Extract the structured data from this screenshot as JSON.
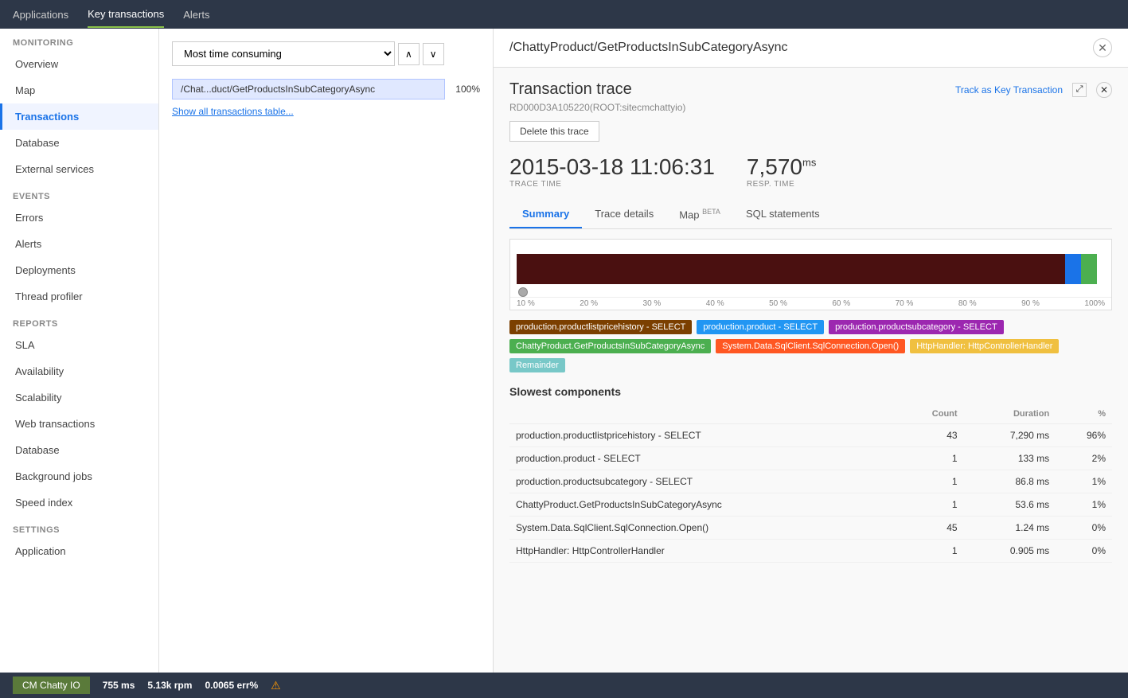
{
  "topNav": {
    "items": [
      {
        "label": "Applications",
        "active": false
      },
      {
        "label": "Key transactions",
        "active": true
      },
      {
        "label": "Alerts",
        "active": false
      }
    ]
  },
  "sidebar": {
    "monitoring": {
      "label": "MONITORING",
      "items": [
        {
          "id": "overview",
          "label": "Overview",
          "active": false
        },
        {
          "id": "map",
          "label": "Map",
          "active": false
        },
        {
          "id": "transactions",
          "label": "Transactions",
          "active": true
        },
        {
          "id": "database",
          "label": "Database",
          "active": false
        },
        {
          "id": "external-services",
          "label": "External services",
          "active": false
        }
      ]
    },
    "events": {
      "label": "EVENTS",
      "items": [
        {
          "id": "errors",
          "label": "Errors",
          "active": false
        },
        {
          "id": "alerts",
          "label": "Alerts",
          "active": false
        },
        {
          "id": "deployments",
          "label": "Deployments",
          "active": false
        },
        {
          "id": "thread-profiler",
          "label": "Thread profiler",
          "active": false
        }
      ]
    },
    "reports": {
      "label": "REPORTS",
      "items": [
        {
          "id": "sla",
          "label": "SLA",
          "active": false
        },
        {
          "id": "availability",
          "label": "Availability",
          "active": false
        },
        {
          "id": "scalability",
          "label": "Scalability",
          "active": false
        },
        {
          "id": "web-transactions",
          "label": "Web transactions",
          "active": false
        },
        {
          "id": "database",
          "label": "Database",
          "active": false
        },
        {
          "id": "background-jobs",
          "label": "Background jobs",
          "active": false
        },
        {
          "id": "speed-index",
          "label": "Speed index",
          "active": false
        }
      ]
    },
    "settings": {
      "label": "SETTINGS",
      "items": [
        {
          "id": "application",
          "label": "Application",
          "active": false
        }
      ]
    }
  },
  "leftPanel": {
    "dropdownLabel": "Most time consuming",
    "transactions": [
      {
        "label": "/Chat...duct/GetProductsInSubCategoryAsync",
        "pct": "100%"
      }
    ],
    "showAllLink": "Show all transactions table..."
  },
  "tracePanel": {
    "headerTitle": "/ChattyProduct/GetProductsInSubCategoryAsync",
    "traceTitle": "Transaction trace",
    "traceId": "RD000D3A105220(ROOT:sitecmchattyio)",
    "deleteBtn": "Delete this trace",
    "trackKeyBtn": "Track as Key Transaction",
    "traceTime": "2015-03-18 11:06:31",
    "traceTimeLabel": "TRACE TIME",
    "respTime": "7,570",
    "respTimeUnit": "ms",
    "respTimeLabel": "RESP. TIME",
    "tabs": [
      {
        "id": "summary",
        "label": "Summary",
        "active": true,
        "beta": false
      },
      {
        "id": "trace-details",
        "label": "Trace details",
        "active": false,
        "beta": false
      },
      {
        "id": "map",
        "label": "Map",
        "active": false,
        "beta": true
      },
      {
        "id": "sql",
        "label": "SQL statements",
        "active": false,
        "beta": false
      }
    ],
    "chartAxis": [
      "10 %",
      "20 %",
      "30 %",
      "40 %",
      "50 %",
      "60 %",
      "70 %",
      "80 %",
      "90 %",
      "100%"
    ],
    "legend": [
      {
        "label": "production.productlistpricehistory - SELECT",
        "color": "#7b3f00"
      },
      {
        "label": "production.product - SELECT",
        "color": "#2196f3"
      },
      {
        "label": "production.productsubcategory - SELECT",
        "color": "#9c27b0"
      },
      {
        "label": "ChattyProduct.GetProductsInSubCategoryAsync",
        "color": "#4caf50"
      },
      {
        "label": "System.Data.SqlClient.SqlConnection.Open()",
        "color": "#ff5722"
      },
      {
        "label": "HttpHandler: HttpControllerHandler",
        "color": "#f0c040"
      },
      {
        "label": "Remainder",
        "color": "#78c8c8"
      }
    ],
    "slowestTitle": "Slowest components",
    "tableHeaders": [
      "",
      "Count",
      "Duration",
      "%"
    ],
    "tableRows": [
      {
        "name": "production.productlistpricehistory - SELECT",
        "count": "43",
        "duration": "7,290 ms",
        "pct": "96%"
      },
      {
        "name": "production.product - SELECT",
        "count": "1",
        "duration": "133 ms",
        "pct": "2%"
      },
      {
        "name": "production.productsubcategory - SELECT",
        "count": "1",
        "duration": "86.8 ms",
        "pct": "1%"
      },
      {
        "name": "ChattyProduct.GetProductsInSubCategoryAsync",
        "count": "1",
        "duration": "53.6 ms",
        "pct": "1%"
      },
      {
        "name": "System.Data.SqlClient.SqlConnection.Open()",
        "count": "45",
        "duration": "1.24 ms",
        "pct": "0%"
      },
      {
        "name": "HttpHandler: HttpControllerHandler",
        "count": "1",
        "duration": "0.905 ms",
        "pct": "0%"
      }
    ]
  },
  "statusBar": {
    "appName": "CM Chatty IO",
    "metrics": [
      {
        "label": "755 ms",
        "key": "response"
      },
      {
        "label": "5.13k rpm",
        "key": "rpm"
      },
      {
        "label": "0.0065 err%",
        "key": "error"
      }
    ]
  }
}
